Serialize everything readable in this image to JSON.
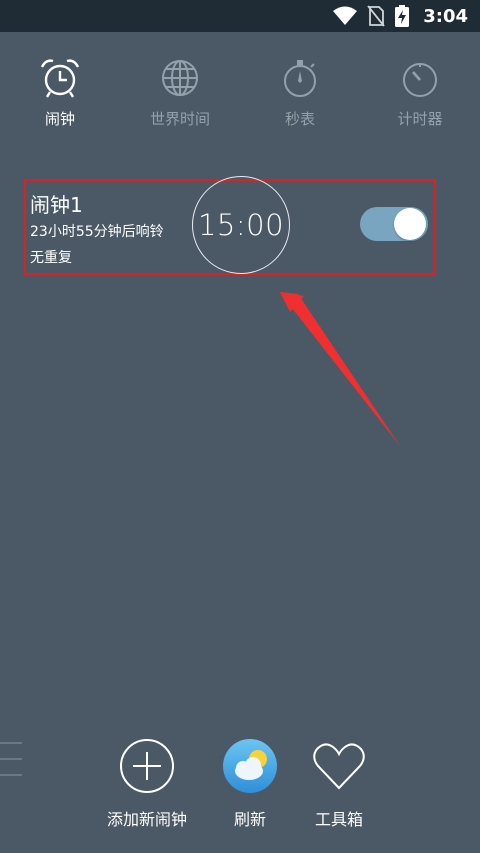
{
  "status_bar": {
    "time": "3:04",
    "icons": [
      "wifi-icon",
      "no-sim-icon",
      "battery-charging-icon"
    ]
  },
  "tabs": [
    {
      "label": "闹钟",
      "icon": "alarm-clock-icon",
      "active": true
    },
    {
      "label": "世界时间",
      "icon": "globe-icon",
      "active": false
    },
    {
      "label": "秒表",
      "icon": "stopwatch-icon",
      "active": false
    },
    {
      "label": "计时器",
      "icon": "timer-icon",
      "active": false
    }
  ],
  "alarm": {
    "name": "闹钟1",
    "time_until": "23小时55分钟后响铃",
    "repeat": "无重复",
    "time": "15:00",
    "enabled": true
  },
  "bottom_bar": {
    "add_label": "添加新闹钟",
    "refresh_label": "刷新",
    "toolbox_label": "工具箱"
  },
  "colors": {
    "background": "#4a5965",
    "status_bar": "#1f2c35",
    "highlight_border": "#e02020",
    "toggle_on": "#7aa5c0",
    "inactive_tab": "#93a1ab"
  }
}
